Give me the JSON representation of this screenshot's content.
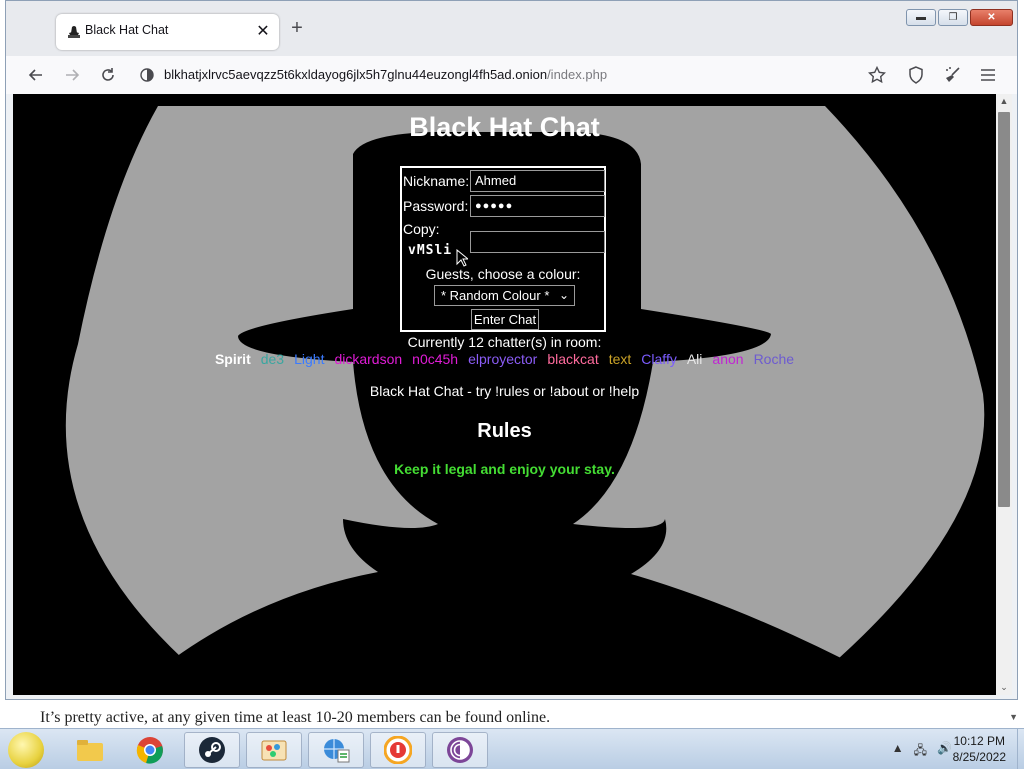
{
  "browser": {
    "tab_title": "Black Hat Chat",
    "tab_close": "✕",
    "new_tab": "+",
    "url_host": "blkhatjxlrvc5aevqzz5t6kxldayog6jlx5h7glnu44euzongl4fh5ad.onion",
    "url_path": "/index.php"
  },
  "page": {
    "title": "Black Hat Chat",
    "nickname_label": "Nickname:",
    "nickname_value": "Ahmed",
    "password_label": "Password:",
    "password_value": "●●●●●",
    "copy_label": "Copy:",
    "captcha": "vMSli",
    "guest_label": "Guests, choose a colour:",
    "colour_option": "* Random Colour *",
    "enter_button": "Enter Chat",
    "chatters_label": "Currently 12 chatter(s) in room:",
    "chatters": [
      {
        "name": "Spirit",
        "color": "#ffffff",
        "bold": true
      },
      {
        "name": "de3",
        "color": "#3aa6a0",
        "bold": false
      },
      {
        "name": "Light",
        "color": "#3b7bff",
        "bold": false
      },
      {
        "name": "dickardson",
        "color": "#e01cd6",
        "bold": false
      },
      {
        "name": "n0c45h",
        "color": "#e01cd6",
        "bold": false
      },
      {
        "name": "elproyector",
        "color": "#8b5cf6",
        "bold": false
      },
      {
        "name": "blackcat",
        "color": "#ff6b9d",
        "bold": false
      },
      {
        "name": "text",
        "color": "#c9a227",
        "bold": false
      },
      {
        "name": "Claffy",
        "color": "#7b5cff",
        "bold": false
      },
      {
        "name": "Ali",
        "color": "#e6e6e6",
        "bold": false
      },
      {
        "name": "anon",
        "color": "#c026d3",
        "bold": false
      },
      {
        "name": "Roche",
        "color": "#6d5bd0",
        "bold": false
      }
    ],
    "footer": "Black Hat Chat - try !rules or !about or !help",
    "rules_title": "Rules",
    "rules_text": "Keep it legal and enjoy your stay."
  },
  "caption": "It’s pretty active, at any given time at least 10-20 members can be found online.",
  "taskbar": {
    "time": "10:12 PM",
    "date": "8/25/2022"
  },
  "colors": {
    "page_bg": "#000000",
    "silhouette_bg": "#a3a3a3",
    "rules_text": "#44dd33"
  }
}
